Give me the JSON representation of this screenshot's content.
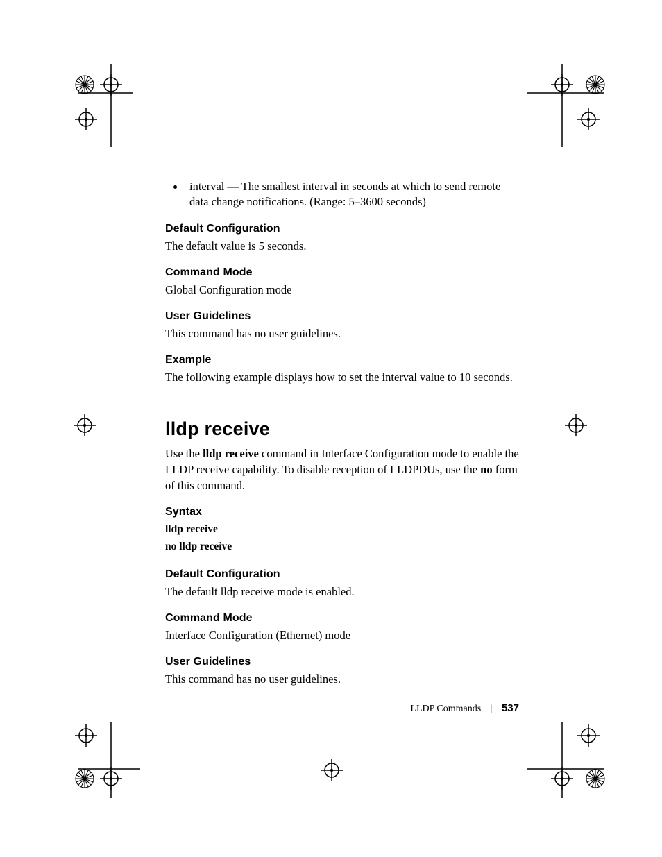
{
  "bullet": {
    "text": "interval — The smallest interval in seconds at which to send remote data change notifications. (Range: 5–3600 seconds)"
  },
  "sec1": {
    "defaultConfig": {
      "head": "Default Configuration",
      "body": "The default value is 5 seconds."
    },
    "commandMode": {
      "head": "Command Mode",
      "body": "Global Configuration mode"
    },
    "userGuide": {
      "head": "User Guidelines",
      "body": "This command has no user guidelines."
    },
    "example": {
      "head": "Example",
      "body": "The following example displays how to set the interval value to 10 seconds."
    }
  },
  "cmd": {
    "title": "lldp receive",
    "intro_pre": "Use the ",
    "intro_bold1": "lldp receive",
    "intro_mid": " command in Interface Configuration mode to enable the LLDP receive capability. To disable reception of LLDPDUs, use the ",
    "intro_bold2": "no",
    "intro_post": " form of this command."
  },
  "sec2": {
    "syntax": {
      "head": "Syntax",
      "line1": "lldp receive",
      "line2": "no lldp receive"
    },
    "defaultConfig": {
      "head": "Default Configuration",
      "body": "The default lldp receive mode is enabled."
    },
    "commandMode": {
      "head": "Command Mode",
      "body": "Interface Configuration (Ethernet) mode"
    },
    "userGuide": {
      "head": "User Guidelines",
      "body": "This command has no user guidelines."
    }
  },
  "footer": {
    "section": "LLDP Commands",
    "page": "537"
  }
}
